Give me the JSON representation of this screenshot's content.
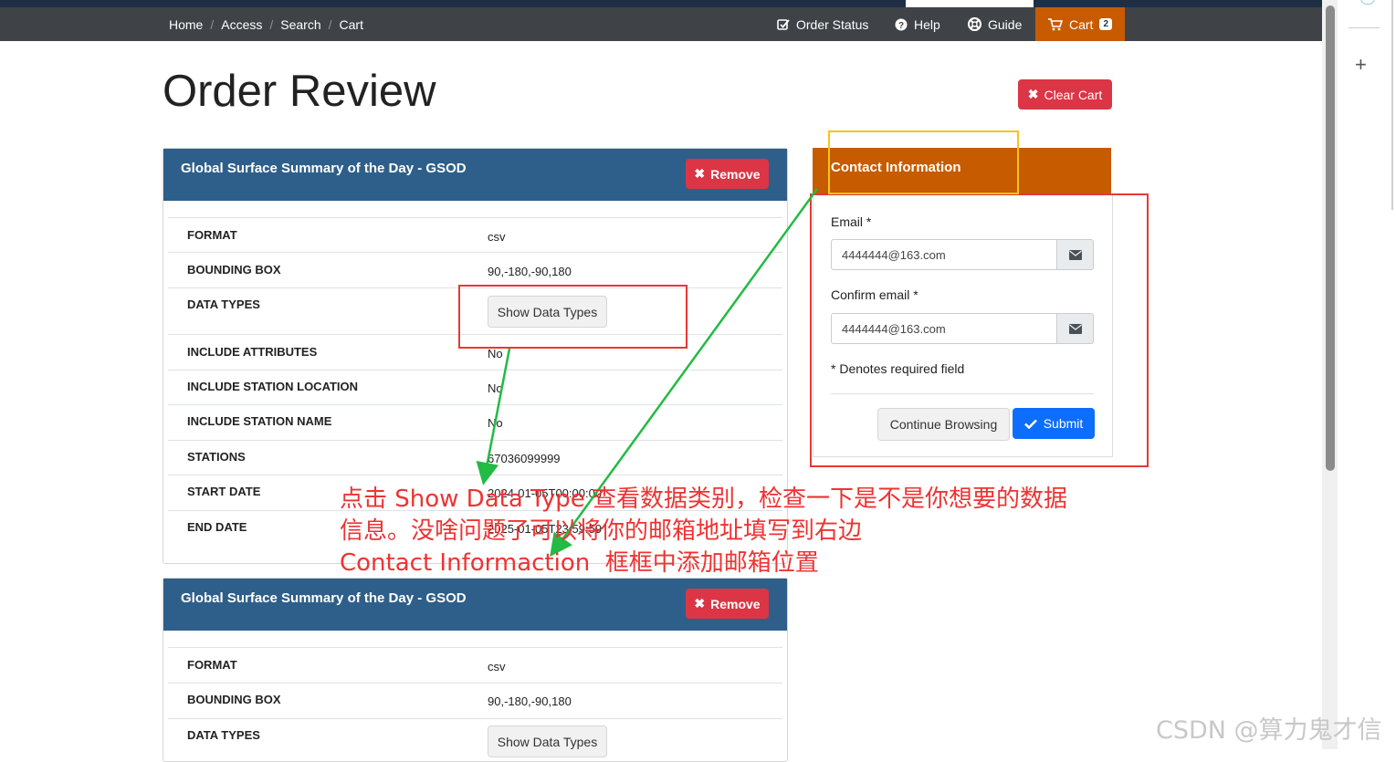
{
  "nav": {
    "breadcrumbs": [
      "Home",
      "Access",
      "Search",
      "Cart"
    ],
    "order_status": "Order Status",
    "help": "Help",
    "guide": "Guide",
    "cart": "Cart",
    "cart_count": "2"
  },
  "page_title": "Order Review",
  "clear_cart": "Clear Cart",
  "orders": [
    {
      "title": "Global Surface Summary of the Day - GSOD",
      "remove": "Remove",
      "rows": [
        {
          "key": "FORMAT",
          "value": "csv"
        },
        {
          "key": "BOUNDING BOX",
          "value": "90,-180,-90,180"
        },
        {
          "key": "DATA TYPES",
          "button": "Show Data Types"
        },
        {
          "key": "INCLUDE ATTRIBUTES",
          "value": "No"
        },
        {
          "key": "INCLUDE STATION LOCATION",
          "value": "No"
        },
        {
          "key": "INCLUDE STATION NAME",
          "value": "No"
        },
        {
          "key": "STATIONS",
          "value": "67036099999"
        },
        {
          "key": "START DATE",
          "value": "2024-01-05T00:00:00"
        },
        {
          "key": "END DATE",
          "value": "2025-01-05T23:59:59"
        }
      ]
    },
    {
      "title": "Global Surface Summary of the Day - GSOD",
      "remove": "Remove",
      "rows": [
        {
          "key": "FORMAT",
          "value": "csv"
        },
        {
          "key": "BOUNDING BOX",
          "value": "90,-180,-90,180"
        },
        {
          "key": "DATA TYPES",
          "button": "Show Data Types"
        }
      ]
    }
  ],
  "contact": {
    "title": "Contact Information",
    "email_label": "Email *",
    "email_value": "4444444@163.com",
    "confirm_label": "Confirm email *",
    "confirm_value": "4444444@163.com",
    "required_note": "* Denotes required field",
    "continue_button": "Continue Browsing",
    "submit_button": "Submit"
  },
  "annotation": {
    "line1": "点击 Show Data Type 查看数据类别，检查一下是不是你想要的数据",
    "line2": "信息。没啥问题了可以将你的邮箱地址填写到右边",
    "line3": "Contact Informaction  框框中添加邮箱位置"
  },
  "watermark": "CSDN @算力鬼才信",
  "colors": {
    "navbar": "#3f4347",
    "cart_accent": "#c85b00",
    "panel_header": "#2e5f8a",
    "danger": "#dc3545",
    "primary": "#0d6efd",
    "annotation_red": "#e53935",
    "arrow_green": "#22bb44",
    "highlight_yellow": "#f5c518"
  }
}
